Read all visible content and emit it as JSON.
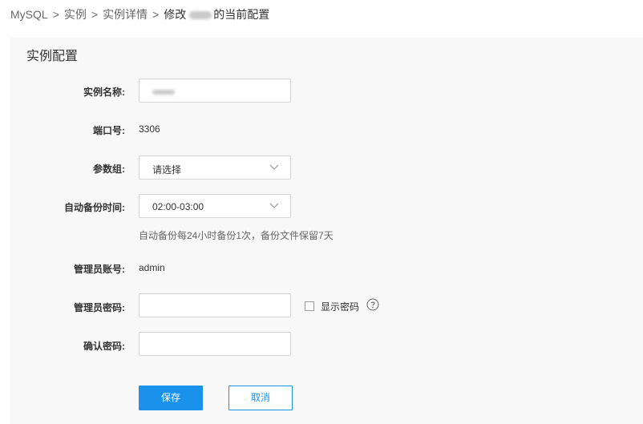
{
  "breadcrumb": {
    "items": [
      "MySQL",
      "实例",
      "实例详情"
    ],
    "current_prefix": "修改",
    "current_suffix": "的当前配置",
    "separator": ">"
  },
  "panel": {
    "title": "实例配置"
  },
  "form": {
    "instance_name": {
      "label": "实例名称:"
    },
    "port": {
      "label": "端口号:",
      "value": "3306"
    },
    "param_group": {
      "label": "参数组:",
      "selected": "请选择"
    },
    "backup_time": {
      "label": "自动备份时间:",
      "selected": "02:00-03:00",
      "hint": "自动备份每24小时备份1次，备份文件保留7天"
    },
    "admin_account": {
      "label": "管理员账号:",
      "value": "admin"
    },
    "admin_password": {
      "label": "管理员密码:",
      "value": "",
      "show_password_label": "显示密码"
    },
    "confirm_password": {
      "label": "确认密码:",
      "value": ""
    }
  },
  "actions": {
    "save_label": "保存",
    "cancel_label": "取消"
  },
  "colors": {
    "accent": "#1a91eb",
    "panel_bg": "#f8f8f8"
  },
  "icons": [
    "chevron-down-icon",
    "help-circle-icon"
  ]
}
